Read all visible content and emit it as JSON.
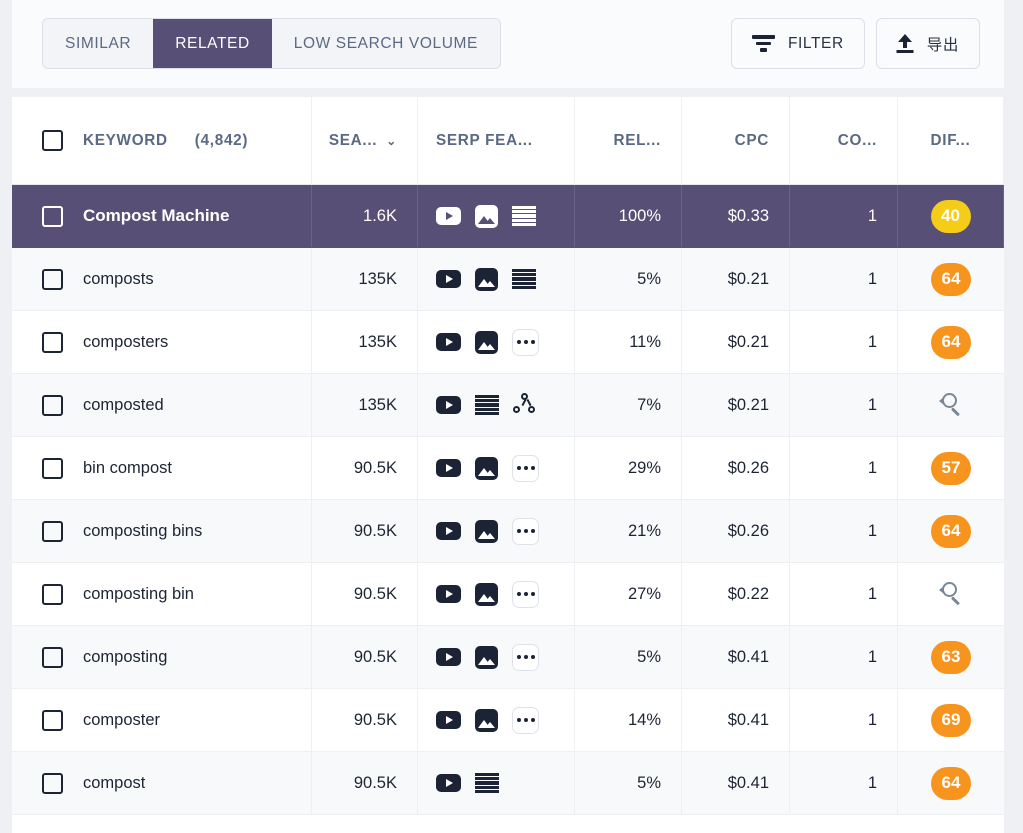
{
  "toolbar": {
    "tabs": [
      {
        "label": "SIMILAR",
        "active": false
      },
      {
        "label": "RELATED",
        "active": true
      },
      {
        "label": "LOW SEARCH VOLUME",
        "active": false
      }
    ],
    "filter_label": "FILTER",
    "export_label": "导出"
  },
  "colors": {
    "accent_purple": "#584f77",
    "badge_orange": "#f7941d",
    "badge_yellow": "#f5cd19",
    "row_alt": "#f8f9fb",
    "page_bg": "#eef0f4"
  },
  "table": {
    "columns": [
      {
        "key": "keyword",
        "label": "KEYWORD",
        "count": "(4,842)",
        "sortable": false
      },
      {
        "key": "volume",
        "label": "SEA...",
        "sortable": true,
        "sort_icon": "chevron-down-icon"
      },
      {
        "key": "serp",
        "label": "SERP FEA...",
        "sortable": false
      },
      {
        "key": "relevance",
        "label": "REL...",
        "sortable": false
      },
      {
        "key": "cpc",
        "label": "CPC",
        "sortable": false
      },
      {
        "key": "competition",
        "label": "CO...",
        "sortable": false
      },
      {
        "key": "difficulty",
        "label": "DIF...",
        "sortable": false
      }
    ],
    "rows": [
      {
        "keyword": "Compost Machine",
        "volume": "1.6K",
        "serp": [
          "video-icon",
          "image-icon",
          "list-icon"
        ],
        "relevance": "100%",
        "cpc": "$0.33",
        "competition": "1",
        "difficulty": "40",
        "difficulty_color": "#f5cd19",
        "selected": true
      },
      {
        "keyword": "composts",
        "volume": "135K",
        "serp": [
          "video-icon",
          "image-icon",
          "list-icon"
        ],
        "relevance": "5%",
        "cpc": "$0.21",
        "competition": "1",
        "difficulty": "64",
        "difficulty_color": "#f7941d",
        "selected": false
      },
      {
        "keyword": "composters",
        "volume": "135K",
        "serp": [
          "video-icon",
          "image-icon",
          "more-icon"
        ],
        "relevance": "11%",
        "cpc": "$0.21",
        "competition": "1",
        "difficulty": "64",
        "difficulty_color": "#f7941d",
        "selected": false
      },
      {
        "keyword": "composted",
        "volume": "135K",
        "serp": [
          "video-icon",
          "list-icon",
          "node-graph-icon"
        ],
        "relevance": "7%",
        "cpc": "$0.21",
        "competition": "1",
        "difficulty": null,
        "difficulty_icon": "refresh-magnifier-icon",
        "selected": false
      },
      {
        "keyword": "bin compost",
        "volume": "90.5K",
        "serp": [
          "video-icon",
          "image-icon",
          "more-icon"
        ],
        "relevance": "29%",
        "cpc": "$0.26",
        "competition": "1",
        "difficulty": "57",
        "difficulty_color": "#f7941d",
        "selected": false
      },
      {
        "keyword": "composting bins",
        "volume": "90.5K",
        "serp": [
          "video-icon",
          "image-icon",
          "more-icon"
        ],
        "relevance": "21%",
        "cpc": "$0.26",
        "competition": "1",
        "difficulty": "64",
        "difficulty_color": "#f7941d",
        "selected": false
      },
      {
        "keyword": "composting bin",
        "volume": "90.5K",
        "serp": [
          "video-icon",
          "image-icon",
          "more-icon"
        ],
        "relevance": "27%",
        "cpc": "$0.22",
        "competition": "1",
        "difficulty": null,
        "difficulty_icon": "refresh-magnifier-icon",
        "selected": false
      },
      {
        "keyword": "composting",
        "volume": "90.5K",
        "serp": [
          "video-icon",
          "image-icon",
          "more-icon"
        ],
        "relevance": "5%",
        "cpc": "$0.41",
        "competition": "1",
        "difficulty": "63",
        "difficulty_color": "#f7941d",
        "selected": false
      },
      {
        "keyword": "composter",
        "volume": "90.5K",
        "serp": [
          "video-icon",
          "image-icon",
          "more-icon"
        ],
        "relevance": "14%",
        "cpc": "$0.41",
        "competition": "1",
        "difficulty": "69",
        "difficulty_color": "#f7941d",
        "selected": false
      },
      {
        "keyword": "compost",
        "volume": "90.5K",
        "serp": [
          "video-icon",
          "list-icon"
        ],
        "relevance": "5%",
        "cpc": "$0.41",
        "competition": "1",
        "difficulty": "64",
        "difficulty_color": "#f7941d",
        "selected": false
      }
    ]
  }
}
